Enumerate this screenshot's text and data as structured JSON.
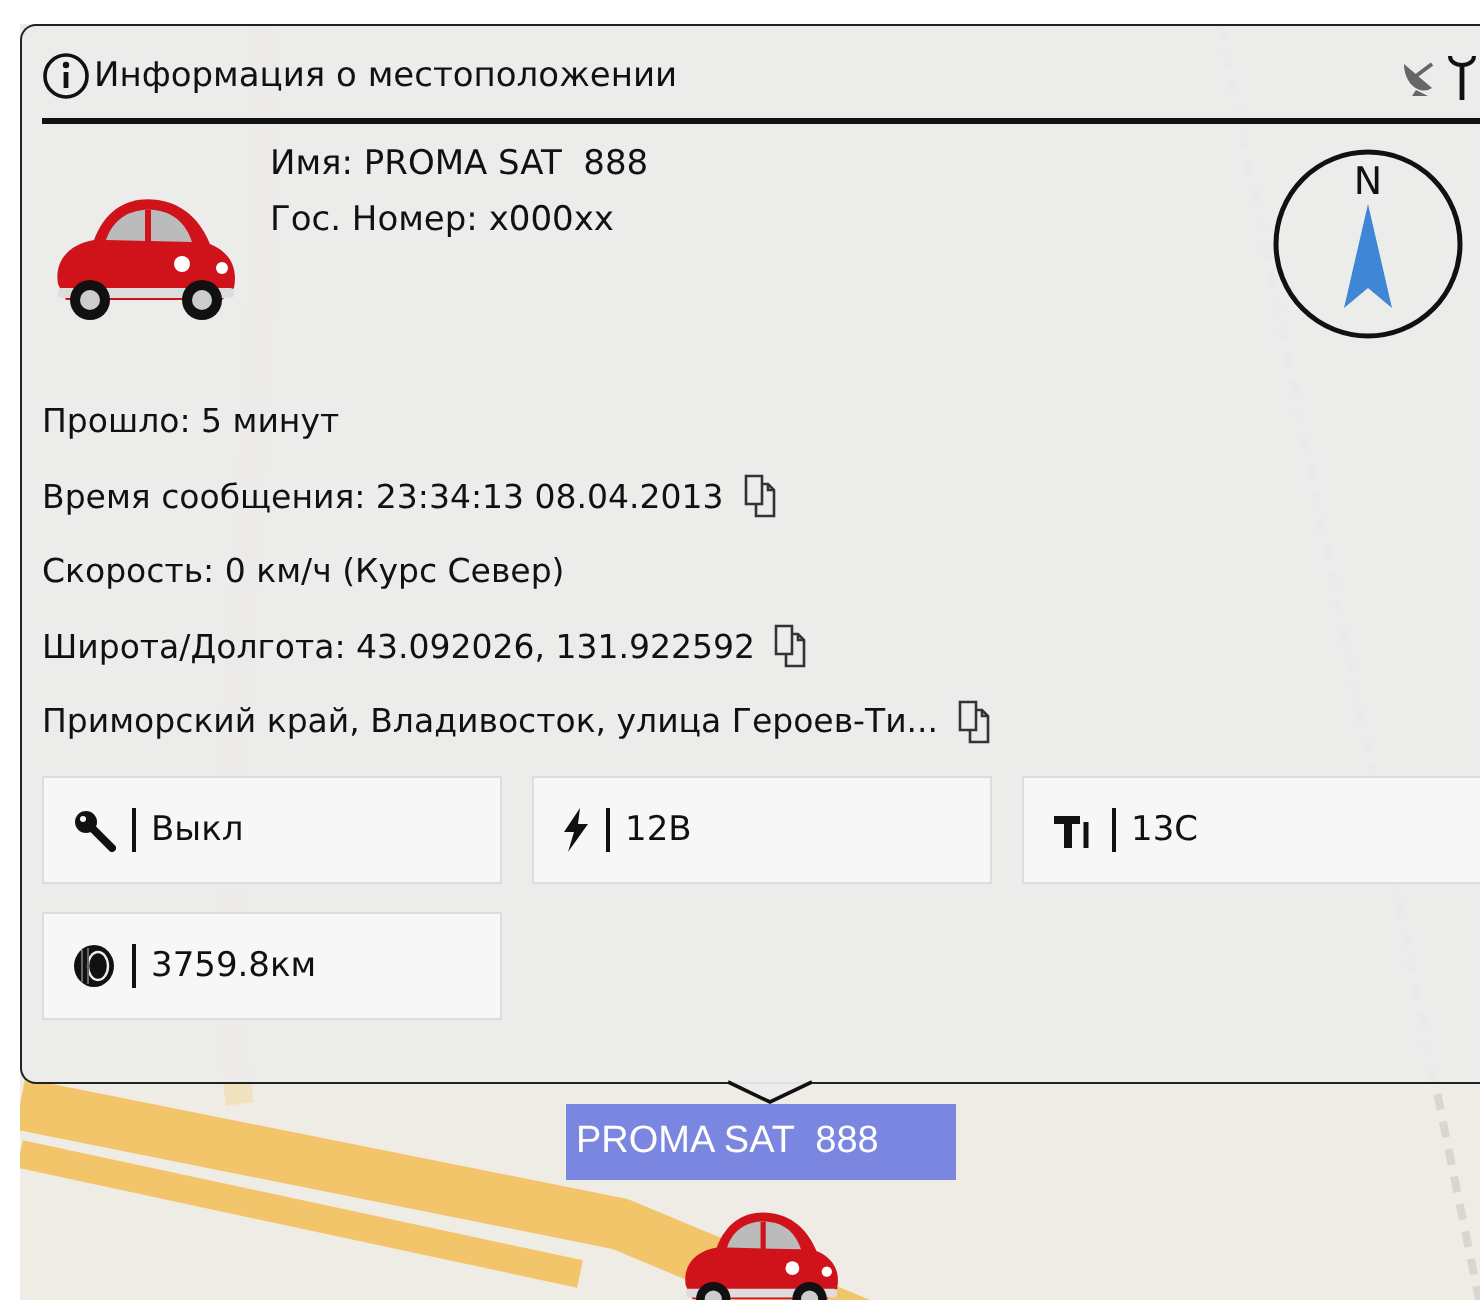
{
  "popup": {
    "title": "Информация о местоположении",
    "vehicle": {
      "name": "Имя: PROMA SAT  888",
      "plate": "Гос. Номер: x000xx"
    },
    "compass": {
      "label": "N"
    },
    "lines": [
      {
        "text": "Прошло: 5 минут",
        "copy_icon": false
      },
      {
        "text": "Время сообщения: 23:34:13 08.04.2013",
        "copy_icon": true
      },
      {
        "text": "Скорость: 0 км/ч (Курс Север)",
        "copy_icon": false
      },
      {
        "text": "Широта/Долгота: 43.092026, 131.922592",
        "copy_icon": true
      },
      {
        "text": "Приморский край, Владивосток, улица Героев-Ти...",
        "copy_icon": true
      }
    ],
    "sensors": [
      {
        "kind": "ignition",
        "value": "Выкл"
      },
      {
        "kind": "voltage",
        "value": "12В"
      },
      {
        "kind": "temperature",
        "value": "13С"
      },
      {
        "kind": "mileage",
        "value": "3759.8км"
      }
    ]
  },
  "marker": {
    "label": "PROMA SAT  888"
  }
}
